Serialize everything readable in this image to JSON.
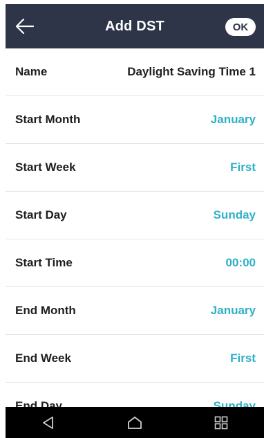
{
  "header": {
    "title": "Add DST",
    "ok_label": "OK"
  },
  "rows": [
    {
      "label": "Name",
      "value": "Daylight Saving Time 1"
    },
    {
      "label": "Start Month",
      "value": "January"
    },
    {
      "label": "Start Week",
      "value": "First"
    },
    {
      "label": "Start Day",
      "value": "Sunday"
    },
    {
      "label": "Start Time",
      "value": "00:00"
    },
    {
      "label": "End Month",
      "value": "January"
    },
    {
      "label": "End Week",
      "value": "First"
    },
    {
      "label": "End Day",
      "value": "Sunday"
    }
  ],
  "colors": {
    "header_bg": "#2e3548",
    "accent_value": "#2eb0c8",
    "nav_bg": "#000000"
  },
  "icons": {
    "back": "arrow-left-icon",
    "nav_back": "triangle-back-icon",
    "nav_home": "home-icon",
    "nav_recents": "grid-icon"
  }
}
